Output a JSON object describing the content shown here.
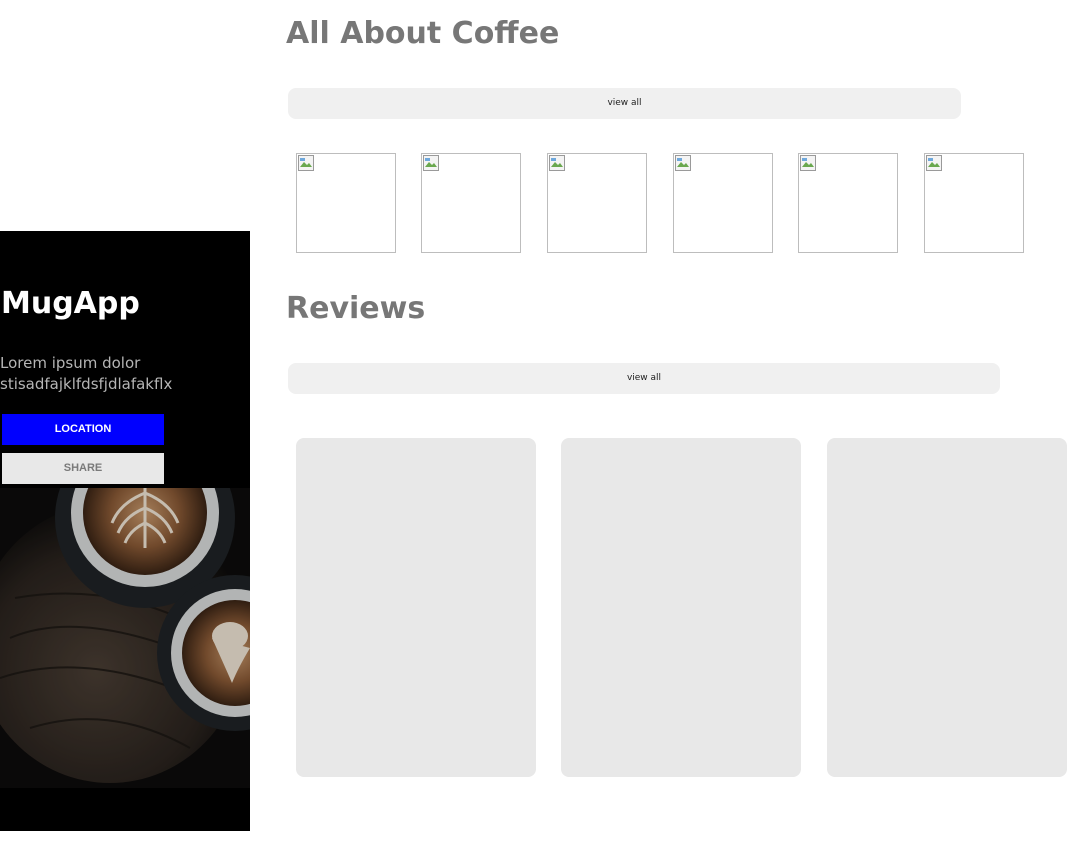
{
  "hero": {
    "title": "MugApp",
    "text": "Lorem ipsum dolor\nstisadfajklfdsfjdlafakflx",
    "location_label": "LOCATION",
    "share_label": "SHARE",
    "photo_icon": "coffee-latte-art-photo"
  },
  "coffee_section": {
    "title": "All About Coffee",
    "view_all_label": "view all",
    "thumbnails": [
      {
        "icon": "broken-image-icon"
      },
      {
        "icon": "broken-image-icon"
      },
      {
        "icon": "broken-image-icon"
      },
      {
        "icon": "broken-image-icon"
      },
      {
        "icon": "broken-image-icon"
      },
      {
        "icon": "broken-image-icon"
      }
    ]
  },
  "reviews_section": {
    "title": "Reviews",
    "view_all_label": "view all",
    "cards": [
      {},
      {},
      {}
    ]
  },
  "colors": {
    "hero_background": "#000000",
    "location_button": "#0000ff",
    "share_button": "#e8e8e8",
    "section_title": "#777777",
    "view_all_background": "#f0f0f0",
    "card_background": "#e8e8e8"
  }
}
